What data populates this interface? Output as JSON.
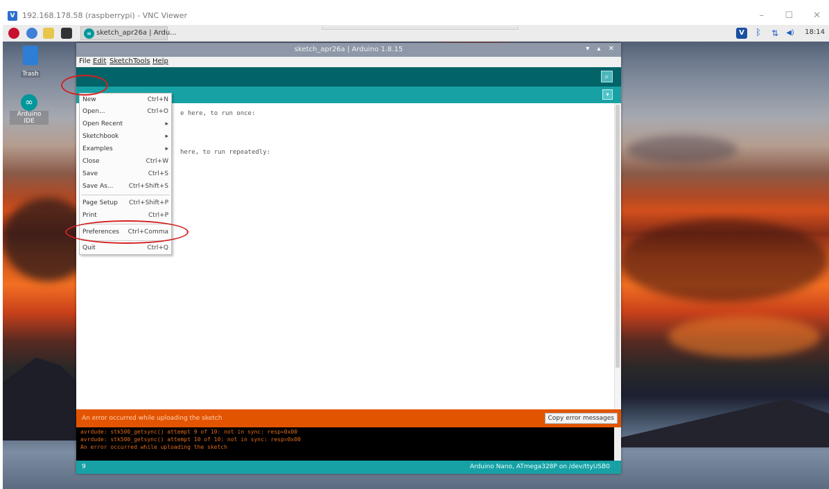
{
  "vnc": {
    "title": "192.168.178.58 (raspberrypi) - VNC Viewer",
    "icon": "vnc-icon",
    "controls": [
      "–",
      "☐",
      "✕"
    ]
  },
  "panel": {
    "icons": [
      "raspberry-icon",
      "browser-icon",
      "file-manager-icon",
      "terminal-icon"
    ],
    "task_label": "sketch_apr26a | Ardu...",
    "clock": "18:14",
    "tray_icons": [
      "vnc-tray-icon",
      "bluetooth-icon",
      "network-icon",
      "volume-icon"
    ]
  },
  "desktop_icons": [
    {
      "label": "Trash",
      "icon": "trash-icon"
    },
    {
      "label": "Arduino IDE",
      "icon": "arduino-icon"
    }
  ],
  "ide": {
    "title": "sketch_apr26a | Arduino 1.8.15",
    "title_controls": "▾ ▴ ✕",
    "menus": [
      "File",
      "Edit",
      "Sketch",
      "Tools",
      "Help"
    ],
    "code_lines": [
      "e here, to run once:",
      "here, to run repeatedly:"
    ],
    "message": "An error occurred while uploading the sketch",
    "copy_button": "Copy error messages",
    "console_lines": [
      "avrdude: stk500_getsync() attempt 9 of 10: not in sync: resp=0x00",
      "avrdude: stk500_getsync() attempt 10 of 10: not in sync: resp=0x00",
      "An error occurred while uploading the sketch"
    ],
    "status_line": "9",
    "status_board": "Arduino Nano, ATmega328P on /dev/ttyUSB0"
  },
  "file_menu": [
    {
      "label": "New",
      "shortcut": "Ctrl+N"
    },
    {
      "label": "Open...",
      "shortcut": "Ctrl+O"
    },
    {
      "label": "Open Recent",
      "shortcut": "▸"
    },
    {
      "label": "Sketchbook",
      "shortcut": "▸"
    },
    {
      "label": "Examples",
      "shortcut": "▸"
    },
    {
      "label": "Close",
      "shortcut": "Ctrl+W"
    },
    {
      "label": "Save",
      "shortcut": "Ctrl+S"
    },
    {
      "label": "Save As...",
      "shortcut": "Ctrl+Shift+S"
    },
    {
      "label": "Page Setup",
      "shortcut": "Ctrl+Shift+P"
    },
    {
      "label": "Print",
      "shortcut": "Ctrl+P"
    },
    {
      "label": "Preferences",
      "shortcut": "Ctrl+Comma"
    },
    {
      "label": "Quit",
      "shortcut": "Ctrl+Q"
    }
  ],
  "colors": {
    "arduino_teal_dark": "#006468",
    "arduino_teal": "#17a1a5",
    "error_orange": "#e35400",
    "annotation_red": "#d42020"
  }
}
